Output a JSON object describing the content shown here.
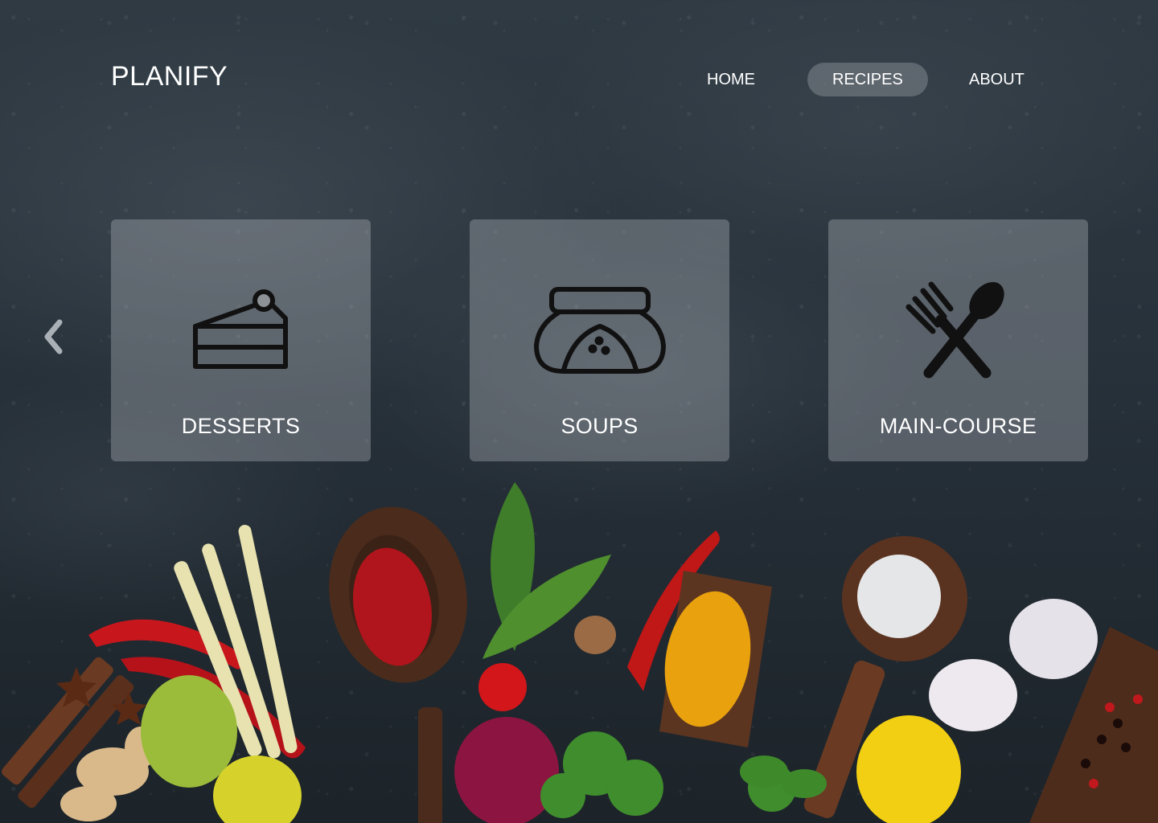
{
  "brand": {
    "name": "PLANIFY"
  },
  "nav": {
    "items": [
      {
        "label": "HOME",
        "active": false
      },
      {
        "label": "RECIPES",
        "active": true
      },
      {
        "label": "ABOUT",
        "active": false
      }
    ]
  },
  "carousel": {
    "prev_icon": "chevron-left-icon",
    "cards": [
      {
        "label": "DESSERTS",
        "icon": "cake-slice-icon"
      },
      {
        "label": "SOUPS",
        "icon": "soup-pot-icon"
      },
      {
        "label": "MAIN-COURSE",
        "icon": "fork-spoon-icon"
      }
    ]
  },
  "colors": {
    "background": "#27313a",
    "card": "#c3c8cd",
    "active_nav": "#c8cdd2",
    "text": "#ffffff",
    "icon": "#111111"
  }
}
